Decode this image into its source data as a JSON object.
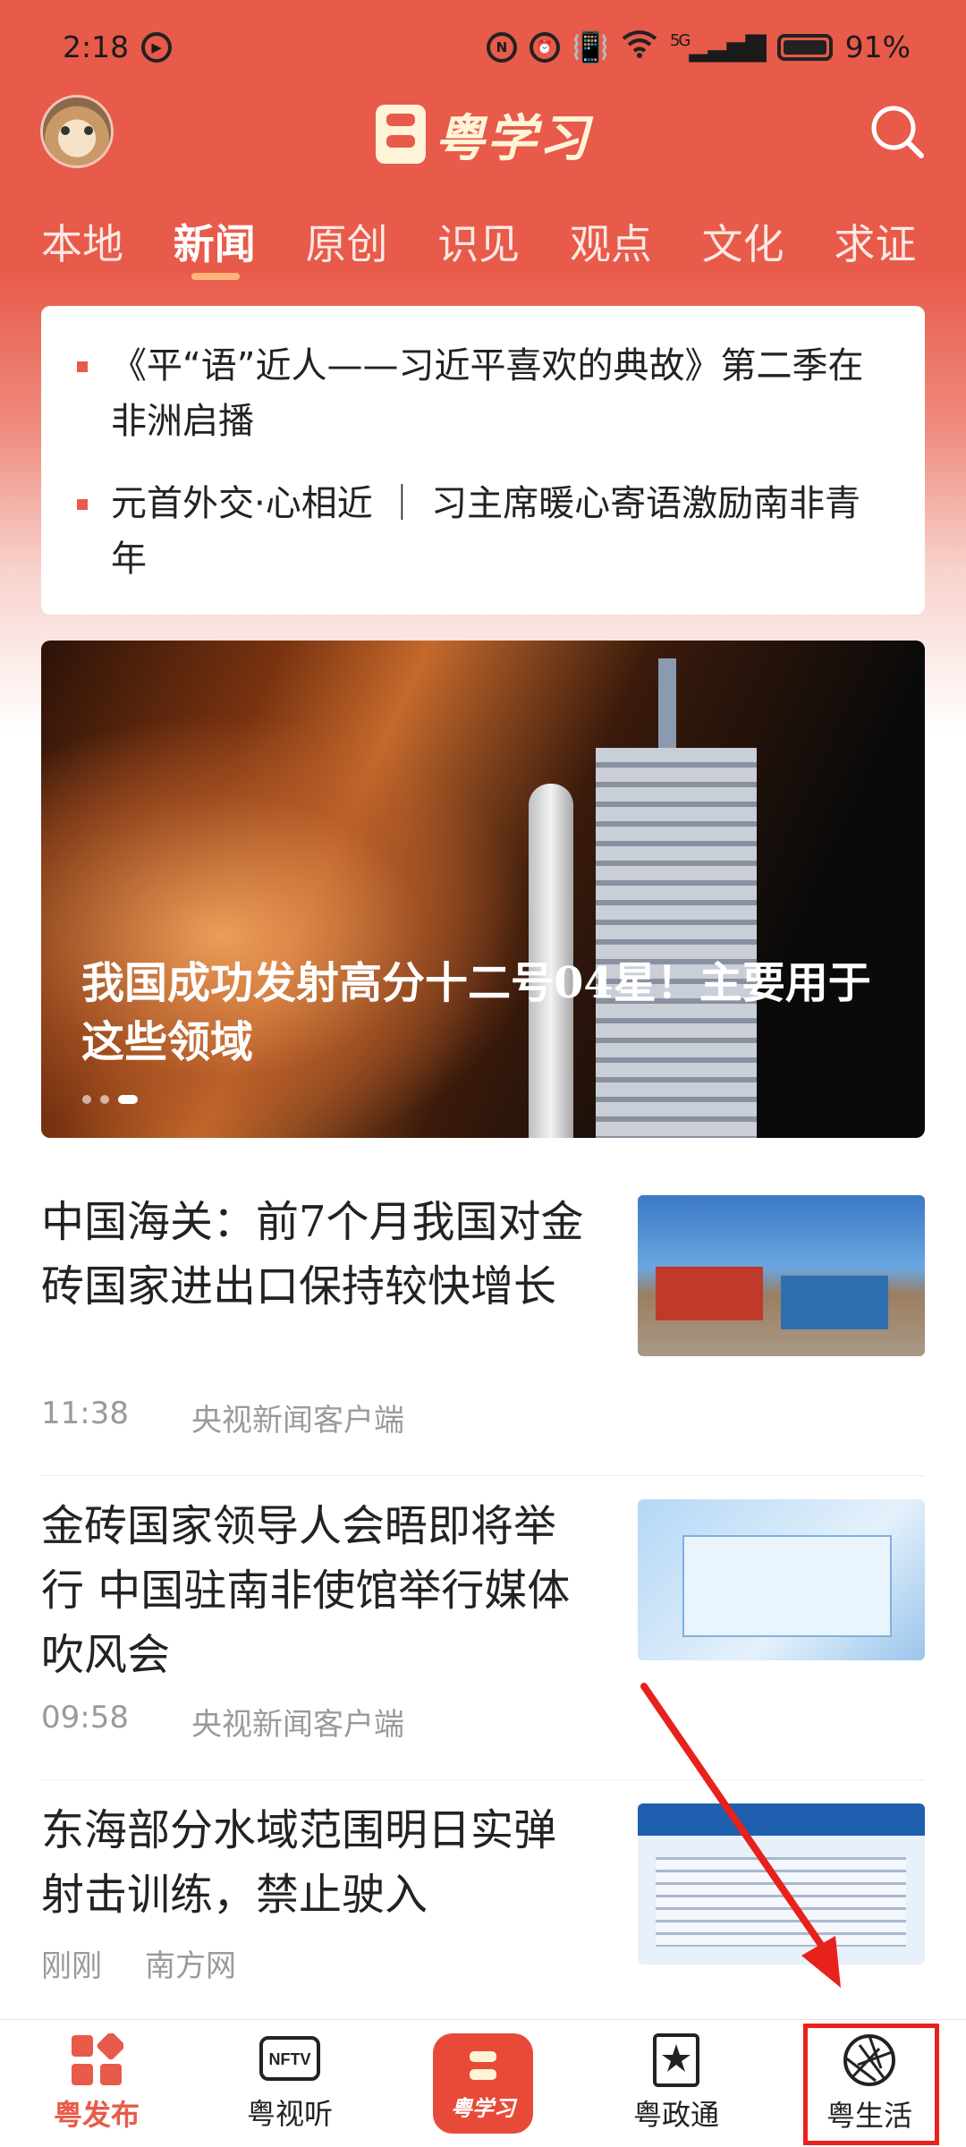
{
  "status_bar": {
    "time": "2:18",
    "network": "5G",
    "battery": "91%"
  },
  "header": {
    "logo_text": "粤学习"
  },
  "tabs": [
    "本地",
    "新闻",
    "原创",
    "识见",
    "观点",
    "文化",
    "求证"
  ],
  "active_tab": "新闻",
  "headlines": [
    "《平“语”近人——习近平喜欢的典故》第二季在非洲启播",
    "元首外交·心相近 ｜ 习主席暖心寄语激励南非青年"
  ],
  "carousel": {
    "caption": "我国成功发射高分十二号04星！主要用于这些领域",
    "slide_count": 3,
    "active_slide": 3
  },
  "news": [
    {
      "title": "中国海关：前7个月我国对金砖国家进出口保持较快增长",
      "time": "11:38",
      "source": "央视新闻客户端"
    },
    {
      "title": "金砖国家领导人会晤即将举行 中国驻南非使馆举行媒体吹风会",
      "time": "09:58",
      "source": "央视新闻客户端"
    },
    {
      "title": "东海部分水域范围明日实弹射击训练，禁止驶入",
      "time": "刚刚",
      "source": "南方网"
    }
  ],
  "bottom_nav": [
    {
      "label": "粤发布",
      "icon": "grid-icon"
    },
    {
      "label": "粤视听",
      "icon": "nftv-icon"
    },
    {
      "label": "粤学习",
      "icon": "logo-icon"
    },
    {
      "label": "粤政通",
      "icon": "star-icon"
    },
    {
      "label": "粤生活",
      "icon": "aperture-icon"
    }
  ],
  "nftv_label": "NFTV",
  "colors": {
    "brand_red": "#e85a4a",
    "annotation_red": "#e8211c"
  }
}
